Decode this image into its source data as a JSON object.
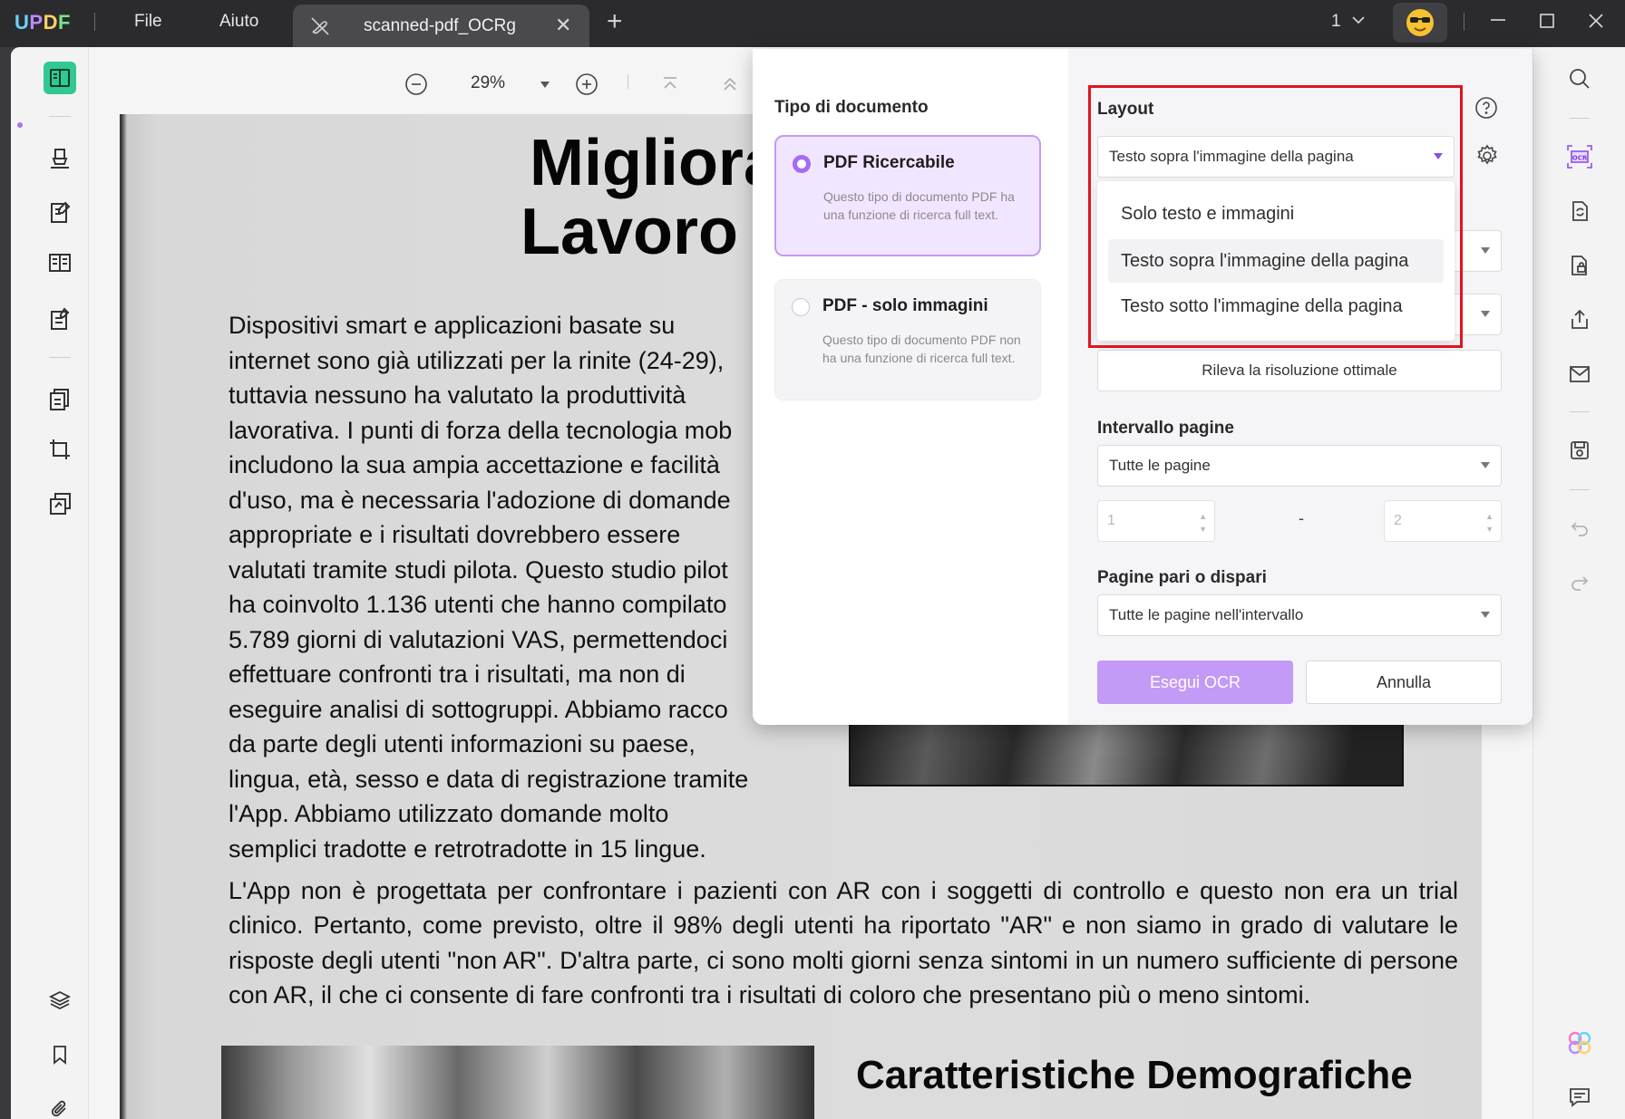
{
  "titlebar": {
    "app_name": "UPDF",
    "menu_file": "File",
    "menu_help": "Aiuto",
    "tab_title": "scanned-pdf_OCRg",
    "page_indicator": "1"
  },
  "toolbar": {
    "zoom": "29%"
  },
  "document": {
    "title_line1": "Migliora la",
    "title_line2": "Lavoro Util",
    "paragraph1": "Dispositivi smart e applicazioni basate su\ninternet sono già utilizzati per la rinite (24-29),\ntuttavia nessuno ha valutato la produttività\nlavorativa. I punti di forza della tecnologia mob\nincludono la sua ampia accettazione e facilità\nd'uso, ma è necessaria l'adozione di domande\nappropriate e i risultati dovrebbero essere\nvalutati tramite studi pilota. Questo studio pilot\nha coinvolto 1.136 utenti che hanno compilato\n5.789 giorni di valutazioni VAS, permettendoci\neffettuare confronti tra i risultati, ma non di\neseguire analisi di sottogruppi. Abbiamo racco\nda parte degli utenti informazioni su paese,\nlingua, età, sesso e data di registrazione tramite\nl'App. Abbiamo utilizzato domande molto\nsemplici tradotte e retrotradotte in 15 lingue.",
    "paragraph2": "L'App non è progettata per confrontare i pazienti con AR con i soggetti di controllo e questo non era un trial clinico. Pertanto, come previsto, oltre il 98% degli utenti ha riportato \"AR\" e non siamo in grado di valutare le risposte degli utenti \"non AR\". D'altra parte, ci sono molti giorni senza sintomi in un numero sufficiente di persone con AR, il che ci consente di fare confronti tra i risultati di coloro che presentano più o meno sintomi.",
    "subheading": "Caratteristiche Demografiche"
  },
  "ocr": {
    "doc_type_title": "Tipo di documento",
    "option_searchable_title": "PDF Ricercabile",
    "option_searchable_desc": "Questo tipo di documento PDF ha una funzione di ricerca full text.",
    "option_images_title": "PDF - solo immagini",
    "option_images_desc": "Questo tipo di documento PDF non ha una funzione di ricerca full text.",
    "layout_title": "Layout",
    "layout_value": "Testo sopra l'immagine della pagina",
    "layout_options": [
      "Solo testo e immagini",
      "Testo sopra l'immagine della pagina",
      "Testo sotto l'immagine della pagina"
    ],
    "detect_resolution": "Rileva la risoluzione ottimale",
    "page_range_title": "Intervallo pagine",
    "page_range_value": "Tutte le pagine",
    "page_from": "1",
    "page_to": "2",
    "range_dash": "-",
    "odd_even_title": "Pagine pari o dispari",
    "odd_even_value": "Tutte le pagine nell'intervallo",
    "run_button": "Esegui OCR",
    "cancel_button": "Annulla"
  },
  "colors": {
    "accent": "#a56cf2",
    "highlight_box": "#e0141e",
    "titlebar": "#2b2b2e"
  }
}
